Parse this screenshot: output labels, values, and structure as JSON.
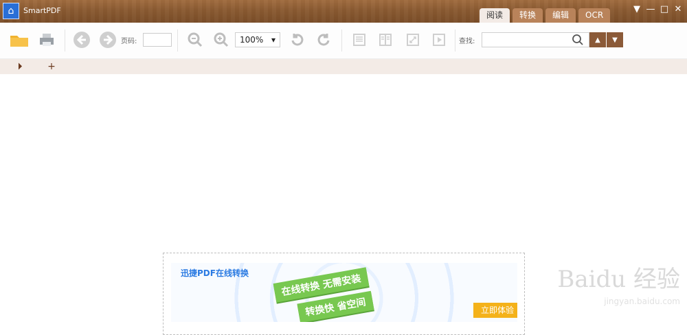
{
  "app": {
    "title": "SmartPDF"
  },
  "mode_tabs": [
    "阅读",
    "转换",
    "编辑",
    "OCR"
  ],
  "toolbar": {
    "page_label": "页码:",
    "zoom_value": "100%",
    "find_label": "查找:"
  },
  "ad": {
    "header": "迅捷PDF在线转换",
    "ribbon_top": "在线转换 无需安装",
    "ribbon_bottom": "转换快 省空间",
    "cta": "立即体验"
  },
  "watermark": {
    "brand": "Baidu 经验",
    "url": "jingyan.baidu.com"
  },
  "colors": {
    "title_bar": "#8a5a31",
    "doc_tabs_bg": "#f3ebe6",
    "nav_button": "#8b5a38",
    "cta": "#f4b21a"
  }
}
